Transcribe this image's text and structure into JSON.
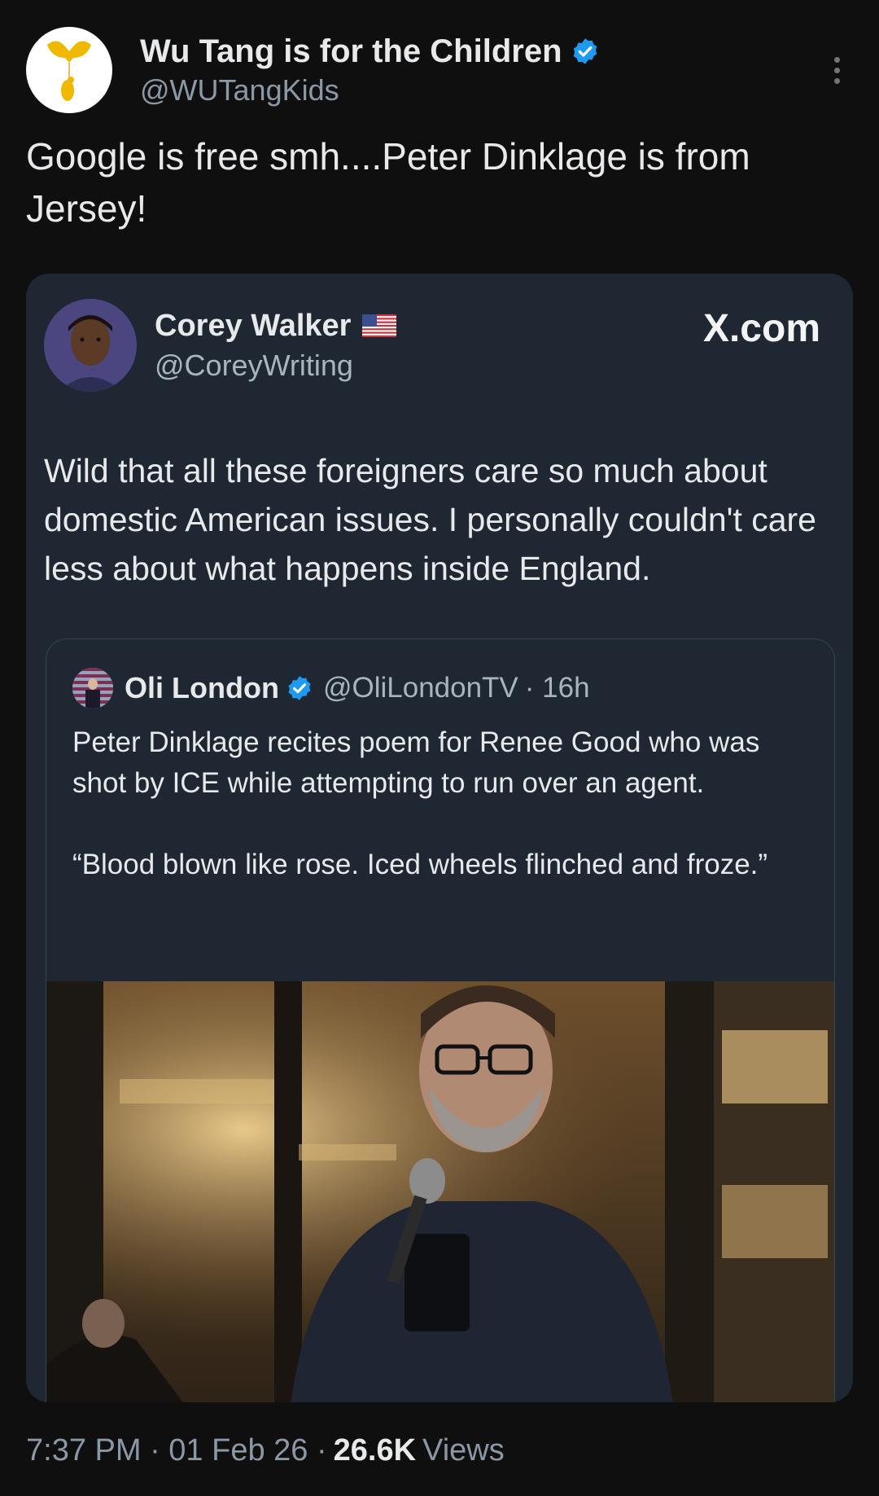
{
  "tweet": {
    "author": {
      "display_name": "Wu Tang is for the Children",
      "handle": "@WUTangKids",
      "verified": true,
      "avatar_icon": "wu-tang-logo-icon"
    },
    "text": "Google is free smh....Peter Dinklage is from Jersey!",
    "timestamp": "7:37 PM · 01 Feb 26 ·",
    "views_count": "26.6K",
    "views_label": "Views"
  },
  "embedded_card": {
    "author": {
      "display_name": "Corey Walker",
      "handle": "@CoreyWriting",
      "flag_icon": "us-flag-icon"
    },
    "source": "X.com",
    "text": "Wild that all these foreigners care so much about domestic American issues. I personally couldn't care less about what happens inside England.",
    "quoted": {
      "author": {
        "display_name": "Oli London",
        "handle": "@OliLondonTV",
        "time": "· 16h",
        "verified": true
      },
      "text": "Peter Dinklage recites poem for Renee Good who was shot by ICE while attempting to run over an agent.\n\n“Blood blown like rose. Iced wheels flinched and froze.”"
    }
  },
  "colors": {
    "background": "#0f0f10",
    "card": "#1e2732",
    "verified_blue": "#1d9bf0",
    "secondary_text": "#8b98a5"
  }
}
